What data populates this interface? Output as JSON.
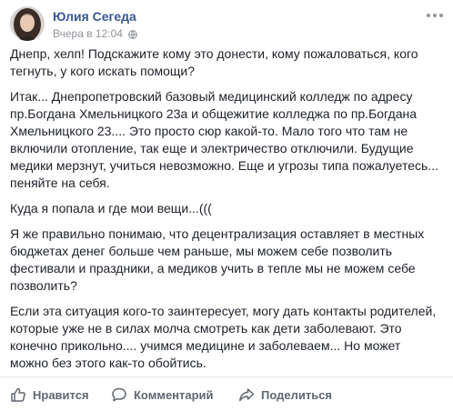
{
  "post": {
    "author": "Юлия Сегеда",
    "time": "Вчера в 12:04",
    "paragraphs": [
      "Днепр, хелп! Подскажите кому это донести, кому пожаловаться, кого\nтегнуть, у кого искать помощи?",
      "Итак... Днепропетровский базовый медицинский колледж по адресу\nпр.Богдана Хмельницкого 23а и общежитие колледжа по пр.Богдана\nХмельницкого 23.... Это просто сюр какой-то. Мало того что там не\nвключили отопление, так еще и электричество отключили. Будущие\nмедики мерзнут, учиться невозможно. Еще и угрозы типа пожалуетесь...\nпеняйте на себя.",
      "Куда я попала и где мои вещи...(((",
      "Я же правильно понимаю, что децентрализация оставляет в местных\nбюджетах денег больше чем раньше, мы можем себе позволить\nфестивали и праздники, а медиков учить в тепле мы не можем себе\nпозволить?",
      "Если эта ситуация кого-то заинтересует, могу дать контакты родителей,\nкоторые уже не в силах молча смотреть как дети заболевают. Это\nконечно прикольно.... учимся медицине и заболеваем... Но может\nможно без этого как-то обойтись."
    ]
  },
  "actions": {
    "like": "Нравится",
    "comment": "Комментарий",
    "share": "Поделиться"
  },
  "icons": {
    "avatar": "avatar-photo",
    "privacy": "globe-icon",
    "menu": "more-options-icon",
    "like": "thumbs-up-icon",
    "comment": "speech-bubble-icon",
    "share": "share-arrow-icon"
  },
  "colors": {
    "author": "#385898",
    "meta": "#90949c",
    "action": "#606770"
  }
}
